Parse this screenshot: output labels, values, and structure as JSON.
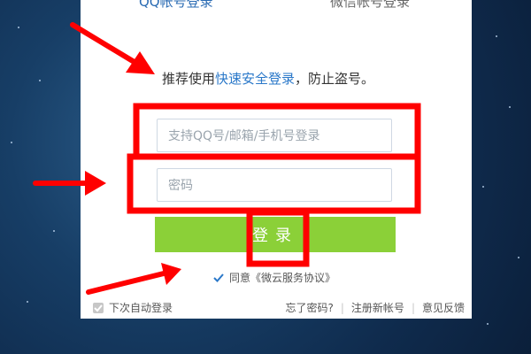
{
  "tabs": {
    "qq_login": "QQ帐号登录",
    "wechat_login": "微信帐号登录"
  },
  "tip": {
    "prefix": "推荐使用",
    "link": "快速安全登录",
    "suffix": "，防止盗号。"
  },
  "form": {
    "account_placeholder": "支持QQ号/邮箱/手机号登录",
    "password_placeholder": "密码",
    "login_label": "登录"
  },
  "agreement": {
    "text": "同意《微云服务协议》"
  },
  "footer": {
    "auto_login": "下次自动登录",
    "forgot_password": "忘了密码?",
    "register": "注册新帐号",
    "feedback": "意见反馈",
    "separator": "|"
  },
  "colors": {
    "login_button": "#8bd038",
    "link": "#2a78c9",
    "annotation": "#ff0000"
  }
}
